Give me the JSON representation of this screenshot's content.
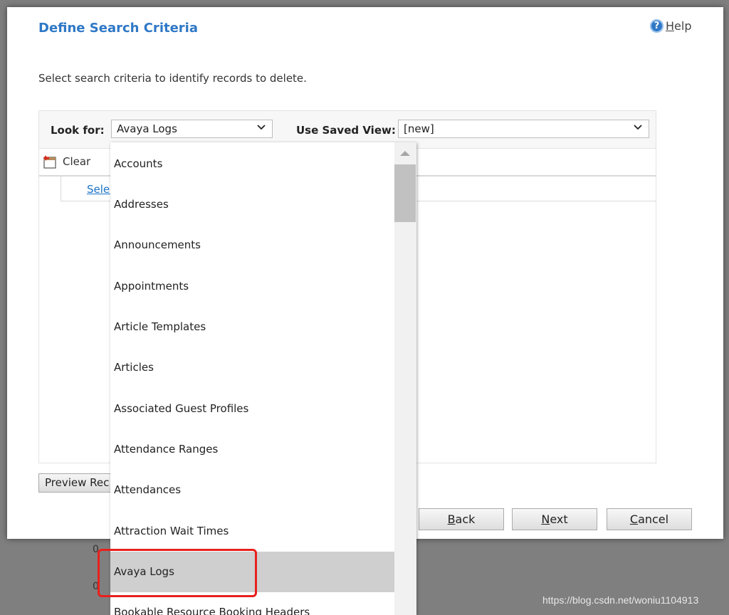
{
  "dialog": {
    "title": "Define Search Criteria",
    "help_label": "Help",
    "help_icon": "?",
    "instruction": "Select search criteria to identify records to delete."
  },
  "criteria": {
    "look_for_label": "Look for:",
    "look_for_value": "Avaya Logs",
    "saved_view_label": "Use Saved View:",
    "saved_view_value": "[new]",
    "clear_label": "Clear",
    "select_link": "Selec"
  },
  "buttons": {
    "preview": "Preview Rec",
    "back": "Back",
    "next": "Next",
    "cancel": "Cancel"
  },
  "dropdown": {
    "items": [
      "Accounts",
      "Addresses",
      "Announcements",
      "Appointments",
      "Article Templates",
      "Articles",
      "Associated Guest Profiles",
      "Attendance Ranges",
      "Attendances",
      "Attraction Wait Times",
      "Avaya Logs",
      "Bookable Resource Booking Headers"
    ],
    "selected": "Avaya Logs"
  },
  "background": {
    "fragment_1": "0",
    "fragment_2": "0"
  },
  "watermark": "https://blog.csdn.net/woniu1104913",
  "colors": {
    "title": "#2f78c6",
    "link": "#1a73c6",
    "selected_item": "#cfcfcf",
    "annotation_border": "#e8201d",
    "overlay": "#7f7f7f"
  },
  "icons": {
    "help": "help-circle-icon",
    "clear": "clear-filter-icon",
    "dropdown": "chevron-down-icon",
    "scroll_up": "scroll-up-arrow-icon"
  }
}
